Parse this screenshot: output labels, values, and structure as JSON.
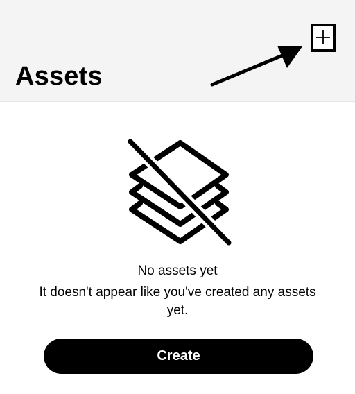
{
  "header": {
    "title": "Assets",
    "add_button_icon": "plus-icon"
  },
  "annotation": {
    "arrow_icon": "arrow-pointer-icon"
  },
  "empty_state": {
    "icon": "layers-off-icon",
    "title": "No assets yet",
    "message": "It doesn't appear like you've created any assets yet."
  },
  "actions": {
    "create_label": "Create"
  },
  "colors": {
    "header_background": "#f4f4f4",
    "button_background": "#000000",
    "button_text": "#ffffff"
  }
}
